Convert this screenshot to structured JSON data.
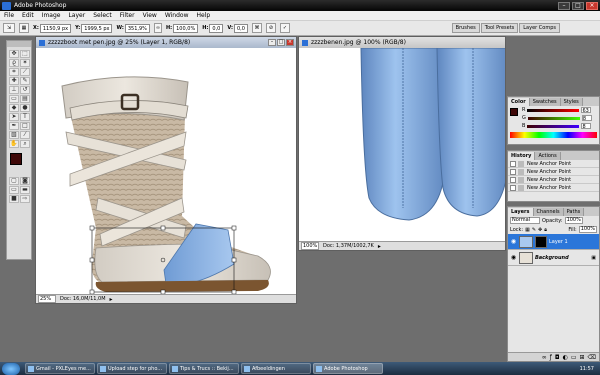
{
  "app": {
    "title": "Adobe Photoshop"
  },
  "menu": [
    "File",
    "Edit",
    "Image",
    "Layer",
    "Select",
    "Filter",
    "View",
    "Window",
    "Help"
  ],
  "options": {
    "fields": [
      {
        "label": "X:",
        "value": "1150,9 px"
      },
      {
        "label": "Y:",
        "value": "1999,5 px"
      },
      {
        "label": "W:",
        "value": "351,9%"
      },
      {
        "label": "H:",
        "value": "100,0%"
      },
      {
        "label": "H:",
        "value": "0,0"
      },
      {
        "label": "V:",
        "value": "0,0"
      }
    ],
    "panel_tabs": [
      "Brushes",
      "Tool Presets",
      "Layer Comps"
    ]
  },
  "doc1": {
    "title": "zzzzzboot met pen.jpg @ 25% (Layer 1, RGB/8)",
    "zoom": "25%",
    "status": "Doc: 16,0M/11,0M"
  },
  "doc2": {
    "title": "zzzzbenen.jpg @ 100% (RGB/8)",
    "zoom": "100%",
    "status": "Doc: 1,37M/1002,7K"
  },
  "color_panel": {
    "tabs": [
      "Color",
      "Swatches",
      "Styles"
    ],
    "sliders": [
      {
        "label": "R",
        "value": "63"
      },
      {
        "label": "G",
        "value": "8"
      },
      {
        "label": "B",
        "value": "8"
      }
    ]
  },
  "history_panel": {
    "tabs": [
      "History",
      "Actions"
    ],
    "items": [
      "New Anchor Point",
      "New Anchor Point",
      "New Anchor Point",
      "New Anchor Point"
    ]
  },
  "layers_panel": {
    "tabs": [
      "Layers",
      "Channels",
      "Paths"
    ],
    "blend_mode": "Normal",
    "opacity_label": "Opacity:",
    "opacity": "100%",
    "lock_label": "Lock:",
    "fill_label": "Fill:",
    "fill": "100%",
    "layers": [
      {
        "name": "Layer 1",
        "selected": true
      },
      {
        "name": "Background",
        "selected": false
      }
    ]
  },
  "taskbar": {
    "items": [
      "Gmail - PXLEyes me...",
      "Upload step for pho...",
      "Tips & Trucs :: Bekij...",
      "Afbeeldingen",
      "Adobe Photoshop"
    ],
    "clock": "11:57"
  },
  "colors": {
    "selection_blue": "#2b76d9",
    "foreground_color": "#3f0808",
    "denim": "#7fa9dd"
  }
}
